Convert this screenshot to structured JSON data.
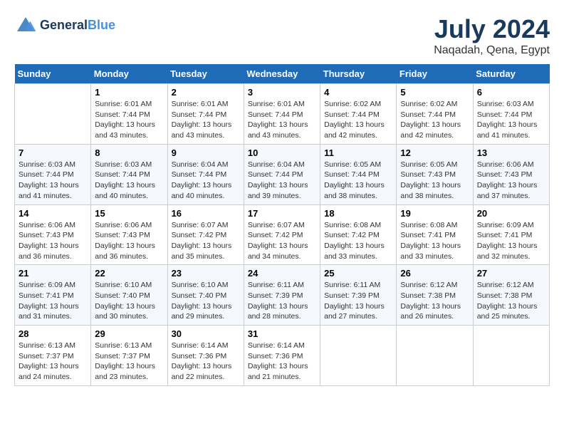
{
  "header": {
    "logo_line1": "General",
    "logo_line2": "Blue",
    "month": "July 2024",
    "location": "Naqadah, Qena, Egypt"
  },
  "days_of_week": [
    "Sunday",
    "Monday",
    "Tuesday",
    "Wednesday",
    "Thursday",
    "Friday",
    "Saturday"
  ],
  "weeks": [
    [
      {
        "day": "",
        "sunrise": "",
        "sunset": "",
        "daylight": ""
      },
      {
        "day": "1",
        "sunrise": "Sunrise: 6:01 AM",
        "sunset": "Sunset: 7:44 PM",
        "daylight": "Daylight: 13 hours and 43 minutes."
      },
      {
        "day": "2",
        "sunrise": "Sunrise: 6:01 AM",
        "sunset": "Sunset: 7:44 PM",
        "daylight": "Daylight: 13 hours and 43 minutes."
      },
      {
        "day": "3",
        "sunrise": "Sunrise: 6:01 AM",
        "sunset": "Sunset: 7:44 PM",
        "daylight": "Daylight: 13 hours and 43 minutes."
      },
      {
        "day": "4",
        "sunrise": "Sunrise: 6:02 AM",
        "sunset": "Sunset: 7:44 PM",
        "daylight": "Daylight: 13 hours and 42 minutes."
      },
      {
        "day": "5",
        "sunrise": "Sunrise: 6:02 AM",
        "sunset": "Sunset: 7:44 PM",
        "daylight": "Daylight: 13 hours and 42 minutes."
      },
      {
        "day": "6",
        "sunrise": "Sunrise: 6:03 AM",
        "sunset": "Sunset: 7:44 PM",
        "daylight": "Daylight: 13 hours and 41 minutes."
      }
    ],
    [
      {
        "day": "7",
        "sunrise": "Sunrise: 6:03 AM",
        "sunset": "Sunset: 7:44 PM",
        "daylight": "Daylight: 13 hours and 41 minutes."
      },
      {
        "day": "8",
        "sunrise": "Sunrise: 6:03 AM",
        "sunset": "Sunset: 7:44 PM",
        "daylight": "Daylight: 13 hours and 40 minutes."
      },
      {
        "day": "9",
        "sunrise": "Sunrise: 6:04 AM",
        "sunset": "Sunset: 7:44 PM",
        "daylight": "Daylight: 13 hours and 40 minutes."
      },
      {
        "day": "10",
        "sunrise": "Sunrise: 6:04 AM",
        "sunset": "Sunset: 7:44 PM",
        "daylight": "Daylight: 13 hours and 39 minutes."
      },
      {
        "day": "11",
        "sunrise": "Sunrise: 6:05 AM",
        "sunset": "Sunset: 7:44 PM",
        "daylight": "Daylight: 13 hours and 38 minutes."
      },
      {
        "day": "12",
        "sunrise": "Sunrise: 6:05 AM",
        "sunset": "Sunset: 7:43 PM",
        "daylight": "Daylight: 13 hours and 38 minutes."
      },
      {
        "day": "13",
        "sunrise": "Sunrise: 6:06 AM",
        "sunset": "Sunset: 7:43 PM",
        "daylight": "Daylight: 13 hours and 37 minutes."
      }
    ],
    [
      {
        "day": "14",
        "sunrise": "Sunrise: 6:06 AM",
        "sunset": "Sunset: 7:43 PM",
        "daylight": "Daylight: 13 hours and 36 minutes."
      },
      {
        "day": "15",
        "sunrise": "Sunrise: 6:06 AM",
        "sunset": "Sunset: 7:43 PM",
        "daylight": "Daylight: 13 hours and 36 minutes."
      },
      {
        "day": "16",
        "sunrise": "Sunrise: 6:07 AM",
        "sunset": "Sunset: 7:42 PM",
        "daylight": "Daylight: 13 hours and 35 minutes."
      },
      {
        "day": "17",
        "sunrise": "Sunrise: 6:07 AM",
        "sunset": "Sunset: 7:42 PM",
        "daylight": "Daylight: 13 hours and 34 minutes."
      },
      {
        "day": "18",
        "sunrise": "Sunrise: 6:08 AM",
        "sunset": "Sunset: 7:42 PM",
        "daylight": "Daylight: 13 hours and 33 minutes."
      },
      {
        "day": "19",
        "sunrise": "Sunrise: 6:08 AM",
        "sunset": "Sunset: 7:41 PM",
        "daylight": "Daylight: 13 hours and 33 minutes."
      },
      {
        "day": "20",
        "sunrise": "Sunrise: 6:09 AM",
        "sunset": "Sunset: 7:41 PM",
        "daylight": "Daylight: 13 hours and 32 minutes."
      }
    ],
    [
      {
        "day": "21",
        "sunrise": "Sunrise: 6:09 AM",
        "sunset": "Sunset: 7:41 PM",
        "daylight": "Daylight: 13 hours and 31 minutes."
      },
      {
        "day": "22",
        "sunrise": "Sunrise: 6:10 AM",
        "sunset": "Sunset: 7:40 PM",
        "daylight": "Daylight: 13 hours and 30 minutes."
      },
      {
        "day": "23",
        "sunrise": "Sunrise: 6:10 AM",
        "sunset": "Sunset: 7:40 PM",
        "daylight": "Daylight: 13 hours and 29 minutes."
      },
      {
        "day": "24",
        "sunrise": "Sunrise: 6:11 AM",
        "sunset": "Sunset: 7:39 PM",
        "daylight": "Daylight: 13 hours and 28 minutes."
      },
      {
        "day": "25",
        "sunrise": "Sunrise: 6:11 AM",
        "sunset": "Sunset: 7:39 PM",
        "daylight": "Daylight: 13 hours and 27 minutes."
      },
      {
        "day": "26",
        "sunrise": "Sunrise: 6:12 AM",
        "sunset": "Sunset: 7:38 PM",
        "daylight": "Daylight: 13 hours and 26 minutes."
      },
      {
        "day": "27",
        "sunrise": "Sunrise: 6:12 AM",
        "sunset": "Sunset: 7:38 PM",
        "daylight": "Daylight: 13 hours and 25 minutes."
      }
    ],
    [
      {
        "day": "28",
        "sunrise": "Sunrise: 6:13 AM",
        "sunset": "Sunset: 7:37 PM",
        "daylight": "Daylight: 13 hours and 24 minutes."
      },
      {
        "day": "29",
        "sunrise": "Sunrise: 6:13 AM",
        "sunset": "Sunset: 7:37 PM",
        "daylight": "Daylight: 13 hours and 23 minutes."
      },
      {
        "day": "30",
        "sunrise": "Sunrise: 6:14 AM",
        "sunset": "Sunset: 7:36 PM",
        "daylight": "Daylight: 13 hours and 22 minutes."
      },
      {
        "day": "31",
        "sunrise": "Sunrise: 6:14 AM",
        "sunset": "Sunset: 7:36 PM",
        "daylight": "Daylight: 13 hours and 21 minutes."
      },
      {
        "day": "",
        "sunrise": "",
        "sunset": "",
        "daylight": ""
      },
      {
        "day": "",
        "sunrise": "",
        "sunset": "",
        "daylight": ""
      },
      {
        "day": "",
        "sunrise": "",
        "sunset": "",
        "daylight": ""
      }
    ]
  ]
}
